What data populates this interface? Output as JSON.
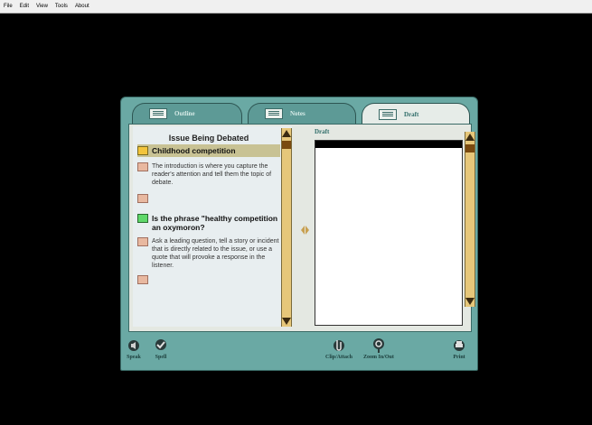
{
  "menu": {
    "items": [
      "File",
      "Edit",
      "View",
      "Tools",
      "About"
    ]
  },
  "tabs": {
    "outline": {
      "label": "Outline"
    },
    "notes": {
      "label": "Notes"
    },
    "draft": {
      "label": "Draft"
    }
  },
  "outline": {
    "heading": "Issue Being Debated",
    "item1": "Childhood competition",
    "note1": "The introduction is where you capture the reader's attention and tell them the topic of debate.",
    "item2": "Is the phrase \"healthy competition an oxymoron?",
    "note2": "Ask a leading question, tell a story or incident that is directly related to the issue, or use a quote that will provoke a response in the listener."
  },
  "draft": {
    "label": "Draft",
    "text": ""
  },
  "toolbar": {
    "speak": "Speak",
    "spell": "Spell",
    "clip_attach": "Clip/Attach",
    "zoom": "Zoom In/Out",
    "print": "Print"
  },
  "colors": {
    "frame": "#6aa9a4",
    "panel": "#e4e8e2",
    "accent": "#e6c77a",
    "selected_row": "#c8c294"
  }
}
